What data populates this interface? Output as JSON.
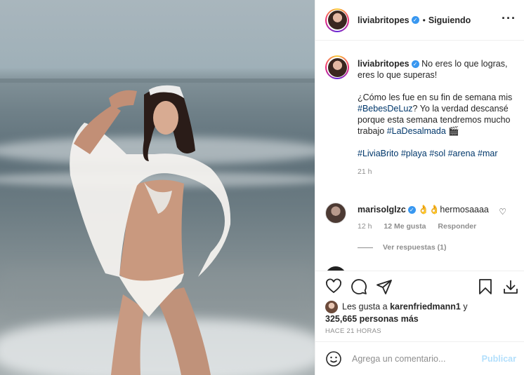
{
  "post": {
    "username": "liviabritopes",
    "follow_status": "Siguiendo",
    "more_icon": "more-horizontal-icon",
    "caption": {
      "line1": "No eres lo que logras, eres lo que superas!",
      "line2_prefix": "¿Cómo les fue en su fin de semana mis ",
      "hashtag_bebes": "#BebesDeLuz",
      "line2_suffix": "? Yo la verdad descansé porque esta semana tendremos mucho trabajo ",
      "hashtag_desalmada": "#LaDesalmada",
      "emoji": "🎬",
      "hashtags": [
        "#LiviaBrito",
        "#playa",
        "#sol",
        "#arena",
        "#mar"
      ],
      "time": "21 h"
    },
    "comment": {
      "username": "marisolglzc",
      "text": "👌👌hermosaaaa",
      "time": "12 h",
      "likes": "12 Me gusta",
      "reply": "Responder",
      "view_replies": "Ver respuestas (1)"
    },
    "likes_text_prefix": "Les gusta a ",
    "likes_user": "karenfriedmann1",
    "likes_text_mid": " y ",
    "likes_count": "325,665 personas más",
    "posted_ago": "HACE 21 HORAS",
    "comment_placeholder": "Agrega un comentario...",
    "publish_label": "Publicar"
  },
  "colors": {
    "link": "#00376b",
    "verified": "#3897f0",
    "muted": "#8e8e8e",
    "publish_disabled": "#b2dffc"
  }
}
